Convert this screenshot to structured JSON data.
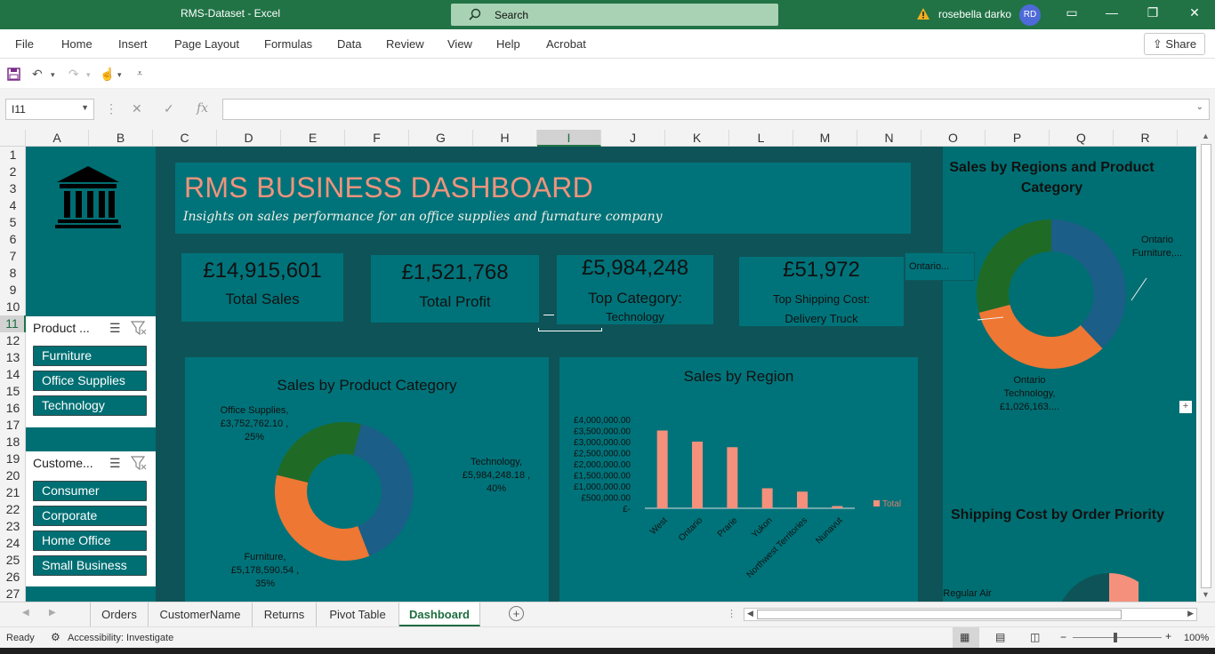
{
  "window": {
    "title": "RMS-Dataset  -  Excel",
    "search_placeholder": "Search",
    "user_name": "rosebella darko",
    "user_initials": "RD"
  },
  "menu": {
    "items": [
      "File",
      "Home",
      "Insert",
      "Page Layout",
      "Formulas",
      "Data",
      "Review",
      "View",
      "Help",
      "Acrobat"
    ],
    "share_label": "Share"
  },
  "formula_bar": {
    "name_box": "I11",
    "fx_label": "fx",
    "content": ""
  },
  "columns": [
    "A",
    "B",
    "C",
    "D",
    "E",
    "F",
    "G",
    "H",
    "I",
    "J",
    "K",
    "L",
    "M",
    "N",
    "O",
    "P",
    "Q",
    "R"
  ],
  "selected_column": "I",
  "rows": [
    "1",
    "2",
    "3",
    "4",
    "5",
    "6",
    "7",
    "8",
    "9",
    "10",
    "11",
    "12",
    "13",
    "14",
    "15",
    "16",
    "17",
    "18",
    "19",
    "20",
    "21",
    "22",
    "23",
    "24",
    "25",
    "26",
    "27"
  ],
  "selected_row": "11",
  "dashboard": {
    "title": "RMS BUSINESS DASHBOARD",
    "subtitle": "Insights on sales performance for an office supplies and furnature company",
    "kpis": [
      {
        "value": "£14,915,601",
        "label": "Total Sales"
      },
      {
        "value": "£1,521,768",
        "label": "Total Profit"
      },
      {
        "value": "£5,984,248",
        "label": "Top Category:",
        "sublabel": "Technology"
      },
      {
        "value": "£51,972",
        "label": "Top Shipping Cost:",
        "sublabel": "Delivery Truck"
      }
    ],
    "colors": {
      "teal": "#006f73",
      "dark_teal": "#0e5357",
      "title_salmon": "#f0937c",
      "blue": "#1b5e87",
      "orange": "#ee7733",
      "green": "#1f6b26",
      "bar": "#f4907c"
    }
  },
  "slicers": [
    {
      "header": "Product ...",
      "items": [
        "Furniture",
        "Office Supplies",
        "Technology"
      ]
    },
    {
      "header": "Custome...",
      "items": [
        "Consumer",
        "Corporate",
        "Home Office",
        "Small Business"
      ]
    }
  ],
  "chart_data": [
    {
      "type": "pie",
      "title": "Sales by Product Category",
      "categories": [
        "Technology",
        "Furniture",
        "Office Supplies"
      ],
      "values": [
        5984248.18,
        5178590.54,
        3752762.1
      ],
      "percentages": [
        40,
        35,
        25
      ],
      "data_labels": [
        "Technology, £5,984,248.18 , 40%",
        "Furniture, £5,178,590.54 , 35%",
        "Office Supplies, £3,752,762.10 , 25%"
      ],
      "colors": [
        "#1b5e87",
        "#ee7733",
        "#1f6b26"
      ]
    },
    {
      "type": "bar",
      "title": "Sales by Region",
      "categories": [
        "West",
        "Ontario",
        "Prarie",
        "Yukon",
        "Northwest Territories",
        "Nunavut"
      ],
      "values": [
        3500000,
        3000000,
        2750000,
        900000,
        750000,
        100000
      ],
      "y_ticks": [
        "£4,000,000.00",
        "£3,500,000.00",
        "£3,000,000.00",
        "£2,500,000.00",
        "£2,000,000.00",
        "£1,500,000.00",
        "£1,000,000.00",
        "£500,000.00",
        "£-"
      ],
      "ylim": [
        0,
        4000000
      ],
      "legend": [
        "Total"
      ],
      "legend_position": "right"
    },
    {
      "type": "pie",
      "title": "Sales by Regions and Product Category",
      "data_labels": [
        "Ontario Furniture,...",
        "Ontario Technology, £1,026,163....",
        "Ontario..."
      ],
      "colors": [
        "#1b5e87",
        "#ee7733",
        "#1f6b26"
      ]
    },
    {
      "type": "pie",
      "title": "Shipping Cost by Order Priority",
      "data_labels": [
        "Regular Air"
      ]
    }
  ],
  "sheet_tabs": [
    "Orders",
    "CustomerName",
    "Returns",
    "Pivot Table",
    "Dashboard"
  ],
  "active_tab": "Dashboard",
  "status": {
    "ready": "Ready",
    "accessibility": "Accessibility: Investigate",
    "zoom": "100%"
  }
}
